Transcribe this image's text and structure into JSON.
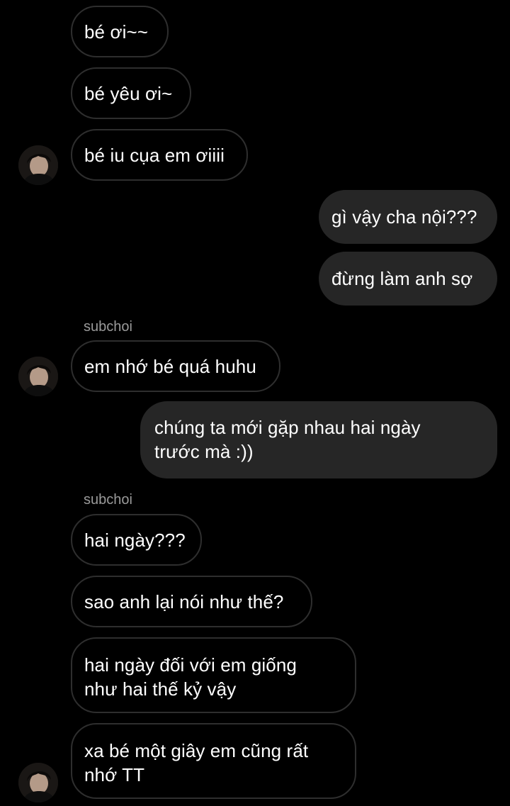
{
  "thread": {
    "messages": [
      {
        "id": "m1",
        "direction": "incoming",
        "text": "bé ơi~~"
      },
      {
        "id": "m2",
        "direction": "incoming",
        "text": "bé yêu ơi~"
      },
      {
        "id": "m3",
        "direction": "incoming",
        "text": "bé iu cụa em ơiiii"
      },
      {
        "id": "m4",
        "direction": "outgoing",
        "text": "gì vậy cha nội???"
      },
      {
        "id": "m5",
        "direction": "outgoing",
        "text": "đừng làm anh sợ"
      },
      {
        "id": "m6",
        "direction": "incoming",
        "sender": "subchoi",
        "text": "em nhớ bé quá huhu"
      },
      {
        "id": "m7",
        "direction": "outgoing",
        "text": "chúng ta mới gặp nhau hai ngày\ntrước mà :))"
      },
      {
        "id": "m8",
        "direction": "incoming",
        "sender": "subchoi",
        "text": "hai ngày???"
      },
      {
        "id": "m9",
        "direction": "incoming",
        "text": "sao anh lại nói như thế?"
      },
      {
        "id": "m10",
        "direction": "incoming",
        "text": "hai ngày đối với em giống\nnhư hai thế kỷ vậy"
      },
      {
        "id": "m11",
        "direction": "incoming",
        "text": "xa bé một giây em cũng rất\nnhớ TT"
      }
    ]
  },
  "colors": {
    "background": "#000000",
    "incoming_border": "#2e2e2e",
    "outgoing_fill": "#262626",
    "text": "#ffffff",
    "sender_text": "#9a9a9a"
  },
  "icons": {
    "avatar": "user-photo-avatar"
  }
}
